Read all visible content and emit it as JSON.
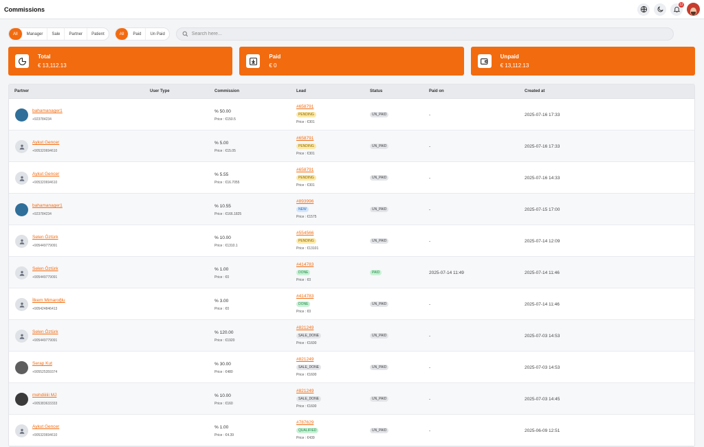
{
  "header": {
    "title": "Commissions",
    "notification_count": "12"
  },
  "filters": {
    "roles": [
      "All",
      "Manager",
      "Sale",
      "Partner",
      "Patient"
    ],
    "payment": [
      "All",
      "Paid",
      "Un Paid"
    ]
  },
  "search": {
    "placeholder": "Search here..."
  },
  "cards": [
    {
      "title": "Total",
      "value": "€ 13,112.13",
      "icon": "pie-chart-icon"
    },
    {
      "title": "Paid",
      "value": "€ 0",
      "icon": "download-box-icon"
    },
    {
      "title": "Unpaid",
      "value": "€ 13,112.13",
      "icon": "wallet-icon"
    }
  ],
  "table": {
    "columns": [
      "Partner",
      "User Type",
      "Commission",
      "Lead",
      "Status",
      "Paid on",
      "Created at"
    ],
    "rows": [
      {
        "name": "bahamanager1",
        "phone": "+923784234",
        "avatar": "photo-blue",
        "commission": "% 50.00",
        "price": "Price : €150.5",
        "lead": "#658791",
        "lead_status": "PENDING",
        "lead_price": "Price : €301",
        "status": "UN_PAID",
        "paid_on": "-",
        "created": "2025-07-16 17:33"
      },
      {
        "name": "Aykut Gencer",
        "phone": "+905320694610",
        "avatar": "default",
        "commission": "% 5.00",
        "price": "Price : €15.05",
        "lead": "#658791",
        "lead_status": "PENDING",
        "lead_price": "Price : €301",
        "status": "UN_PAID",
        "paid_on": "-",
        "created": "2025-07-16 17:33"
      },
      {
        "name": "Aykut Gencer",
        "phone": "+905320694610",
        "avatar": "default",
        "commission": "% 5.55",
        "price": "Price : €16.7055",
        "lead": "#658791",
        "lead_status": "PENDING",
        "lead_price": "Price : €301",
        "status": "UN_PAID",
        "paid_on": "-",
        "created": "2025-07-16 14:33"
      },
      {
        "name": "bahamanager1",
        "phone": "+923784234",
        "avatar": "photo-blue",
        "commission": "% 10.55",
        "price": "Price : €166.1825",
        "lead": "#893996",
        "lead_status": "NEW",
        "lead_price": "Price : €1575",
        "status": "UN_PAID",
        "paid_on": "-",
        "created": "2025-07-15 17:00"
      },
      {
        "name": "Selen Öztürk",
        "phone": "+905449779091",
        "avatar": "default",
        "commission": "% 10.00",
        "price": "Price : €1310.1",
        "lead": "#554566",
        "lead_status": "PENDING",
        "lead_price": "Price : €13101",
        "status": "UN_PAID",
        "paid_on": "-",
        "created": "2025-07-14 12:09"
      },
      {
        "name": "Selen Öztürk",
        "phone": "+905449779091",
        "avatar": "default",
        "commission": "% 1.00",
        "price": "Price : €0",
        "lead": "#414783",
        "lead_status": "DONE",
        "lead_price": "Price : €0",
        "status": "PAID",
        "paid_on": "2025-07-14 11:49",
        "created": "2025-07-14 11:46"
      },
      {
        "name": "İlkem Mimaroğlu",
        "phone": "+905424846413",
        "avatar": "default",
        "commission": "% 3.00",
        "price": "Price : €0",
        "lead": "#414783",
        "lead_status": "DONE",
        "lead_price": "Price : €0",
        "status": "UN_PAID",
        "paid_on": "-",
        "created": "2025-07-14 11:46"
      },
      {
        "name": "Selen Öztürk",
        "phone": "+905449779091",
        "avatar": "default",
        "commission": "% 120.00",
        "price": "Price : €1920",
        "lead": "#821249",
        "lead_status": "SALE_DONE",
        "lead_price": "Price : €1600",
        "status": "UN_PAID",
        "paid_on": "-",
        "created": "2025-07-03 14:53"
      },
      {
        "name": "Serap Kut",
        "phone": "+905525359374",
        "avatar": "photo-gray",
        "commission": "% 30.00",
        "price": "Price : €480",
        "lead": "#821249",
        "lead_status": "SALE_DONE",
        "lead_price": "Price : €1600",
        "status": "UN_PAID",
        "paid_on": "-",
        "created": "2025-07-03 14:53"
      },
      {
        "name": "mehdiiiiii MJ",
        "phone": "+905383633333",
        "avatar": "photo-dark",
        "commission": "% 10.00",
        "price": "Price : €160",
        "lead": "#821249",
        "lead_status": "SALE_DONE",
        "lead_price": "Price : €1600",
        "status": "UN_PAID",
        "paid_on": "-",
        "created": "2025-07-03 14:45"
      },
      {
        "name": "Aykut Gencer",
        "phone": "+905320694610",
        "avatar": "default",
        "commission": "% 1.00",
        "price": "Price : €4.39",
        "lead": "#787629",
        "lead_status": "QUALIFIED",
        "lead_price": "Price : €439",
        "status": "UN_PAID",
        "paid_on": "-",
        "created": "2025-06-09 12:51"
      }
    ]
  }
}
